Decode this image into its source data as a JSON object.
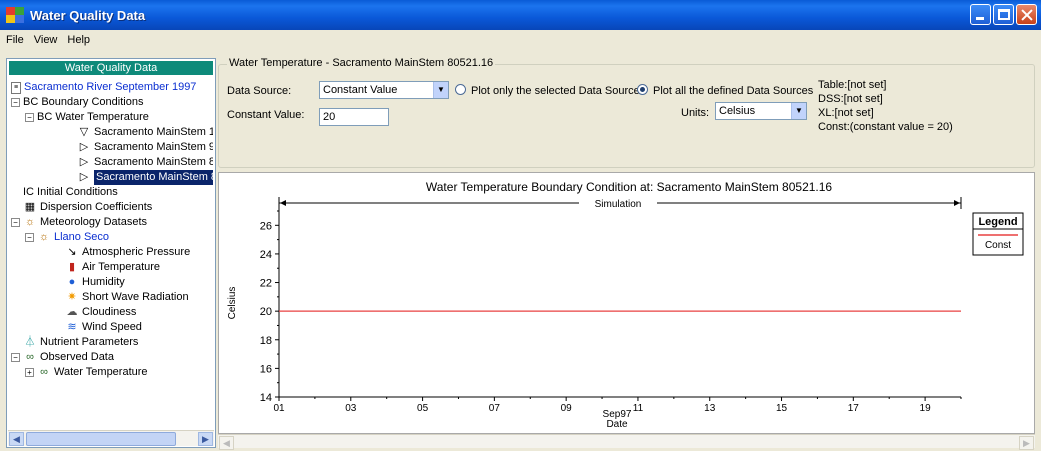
{
  "window": {
    "title": "Water Quality Data"
  },
  "menu": [
    "File",
    "View",
    "Help"
  ],
  "tree": {
    "header": "Water Quality Data",
    "nodes": [
      {
        "label": "Sacramento River September 1997"
      },
      {
        "label": "BC  Boundary Conditions"
      },
      {
        "label": "BC  Water Temperature"
      },
      {
        "label": "Sacramento MainStem 1"
      },
      {
        "label": "Sacramento MainStem 9"
      },
      {
        "label": "Sacramento MainStem 8"
      },
      {
        "label": "Sacramento MainStem 8"
      },
      {
        "label": "IC  Initial Conditions"
      },
      {
        "label": "Dispersion Coefficients"
      },
      {
        "label": "Meteorology Datasets"
      },
      {
        "label": "Llano Seco"
      },
      {
        "label": "Atmospheric Pressure"
      },
      {
        "label": "Air Temperature"
      },
      {
        "label": "Humidity"
      },
      {
        "label": "Short Wave Radiation"
      },
      {
        "label": "Cloudiness"
      },
      {
        "label": "Wind Speed"
      },
      {
        "label": "Nutrient Parameters"
      },
      {
        "label": "Observed Data"
      },
      {
        "label": "Water Temperature"
      }
    ]
  },
  "form": {
    "group_title": "Water Temperature - Sacramento MainStem 80521.16",
    "data_source_label": "Data Source:",
    "data_source_value": "Constant Value",
    "radio_selected_label": "Plot only the selected Data Source",
    "radio_all_label": "Plot all the defined Data Sources",
    "constant_label": "Constant Value:",
    "constant_value": "20",
    "units_label": "Units:",
    "units_value": "Celsius",
    "info": [
      "Table:[not set]",
      "DSS:[not set]",
      "XL:[not set]",
      "Const:(constant value = 20)"
    ]
  },
  "chart_data": {
    "type": "line",
    "title": "Water Temperature Boundary Condition at: Sacramento MainStem 80521.16",
    "xlabel": "Date",
    "x_sublabel": "Sep97",
    "ylabel": "Celsius",
    "x_ticks": [
      "01",
      "03",
      "05",
      "07",
      "09",
      "11",
      "13",
      "15",
      "17",
      "19"
    ],
    "x_range": [
      1,
      20
    ],
    "y_ticks": [
      14,
      16,
      18,
      20,
      22,
      24,
      26
    ],
    "ylim": [
      14,
      27
    ],
    "annotation": "Simulation",
    "legend": {
      "title": "Legend",
      "entries": [
        "Const"
      ],
      "placement": "right"
    },
    "series": [
      {
        "name": "Const",
        "color": "#e84040",
        "x": [
          1,
          20
        ],
        "y": [
          20,
          20
        ]
      }
    ]
  }
}
